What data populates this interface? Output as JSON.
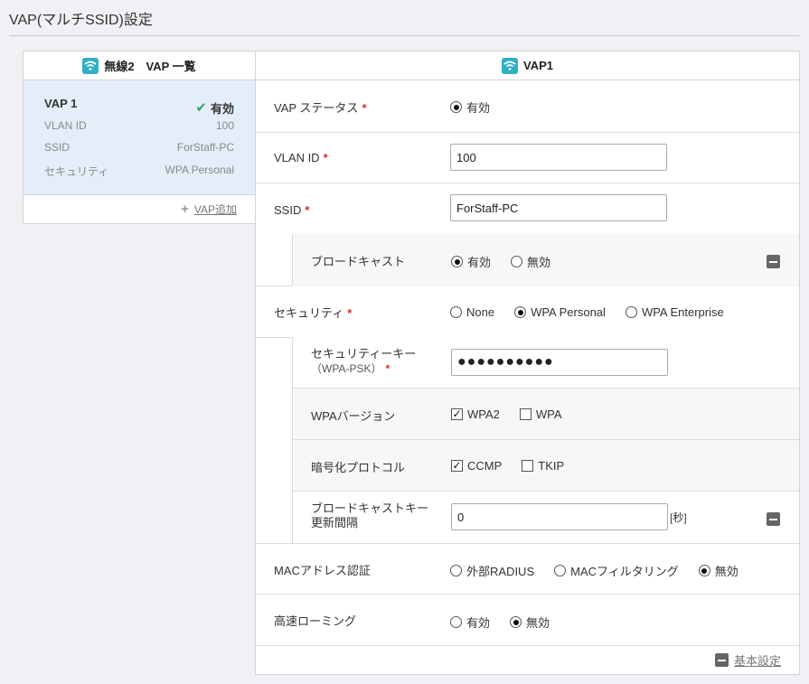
{
  "page_title": "VAP(マルチSSID)設定",
  "left": {
    "header": "無線2　VAP 一覧",
    "card": {
      "name": "VAP 1",
      "status": "有効",
      "rows": [
        {
          "label": "VLAN ID",
          "value": "100"
        },
        {
          "label": "SSID",
          "value": "ForStaff-PC"
        },
        {
          "label": "セキュリティ",
          "value": "WPA Personal"
        }
      ]
    },
    "add_link": "VAP追加"
  },
  "right": {
    "header": "VAP1",
    "vap_status": {
      "label": "VAP ステータス",
      "req": "*",
      "option": "有効"
    },
    "vlan": {
      "label": "VLAN ID",
      "req": "*",
      "value": "100"
    },
    "ssid": {
      "label": "SSID",
      "req": "*",
      "value": "ForStaff-PC"
    },
    "broadcast": {
      "label": "ブロードキャスト",
      "options": [
        "有効",
        "無効"
      ]
    },
    "security": {
      "label": "セキュリティ",
      "req": "*",
      "options": [
        "None",
        "WPA Personal",
        "WPA Enterprise"
      ]
    },
    "psk": {
      "label1": "セキュリティーキー",
      "label2": "（WPA-PSK）",
      "req": "*",
      "value": "●●●●●●●●●●"
    },
    "wpa_version": {
      "label": "WPAバージョン",
      "options": [
        "WPA2",
        "WPA"
      ]
    },
    "cipher": {
      "label": "暗号化プロトコル",
      "options": [
        "CCMP",
        "TKIP"
      ]
    },
    "rekey": {
      "label1": "ブロードキャストキー",
      "label2": "更新間隔",
      "value": "0",
      "unit": "[秒]"
    },
    "mac_auth": {
      "label": "MACアドレス認証",
      "options": [
        "外部RADIUS",
        "MACフィルタリング",
        "無効"
      ]
    },
    "fast_roaming": {
      "label": "高速ローミング",
      "options": [
        "有効",
        "無効"
      ]
    },
    "footer_link": "基本設定"
  }
}
